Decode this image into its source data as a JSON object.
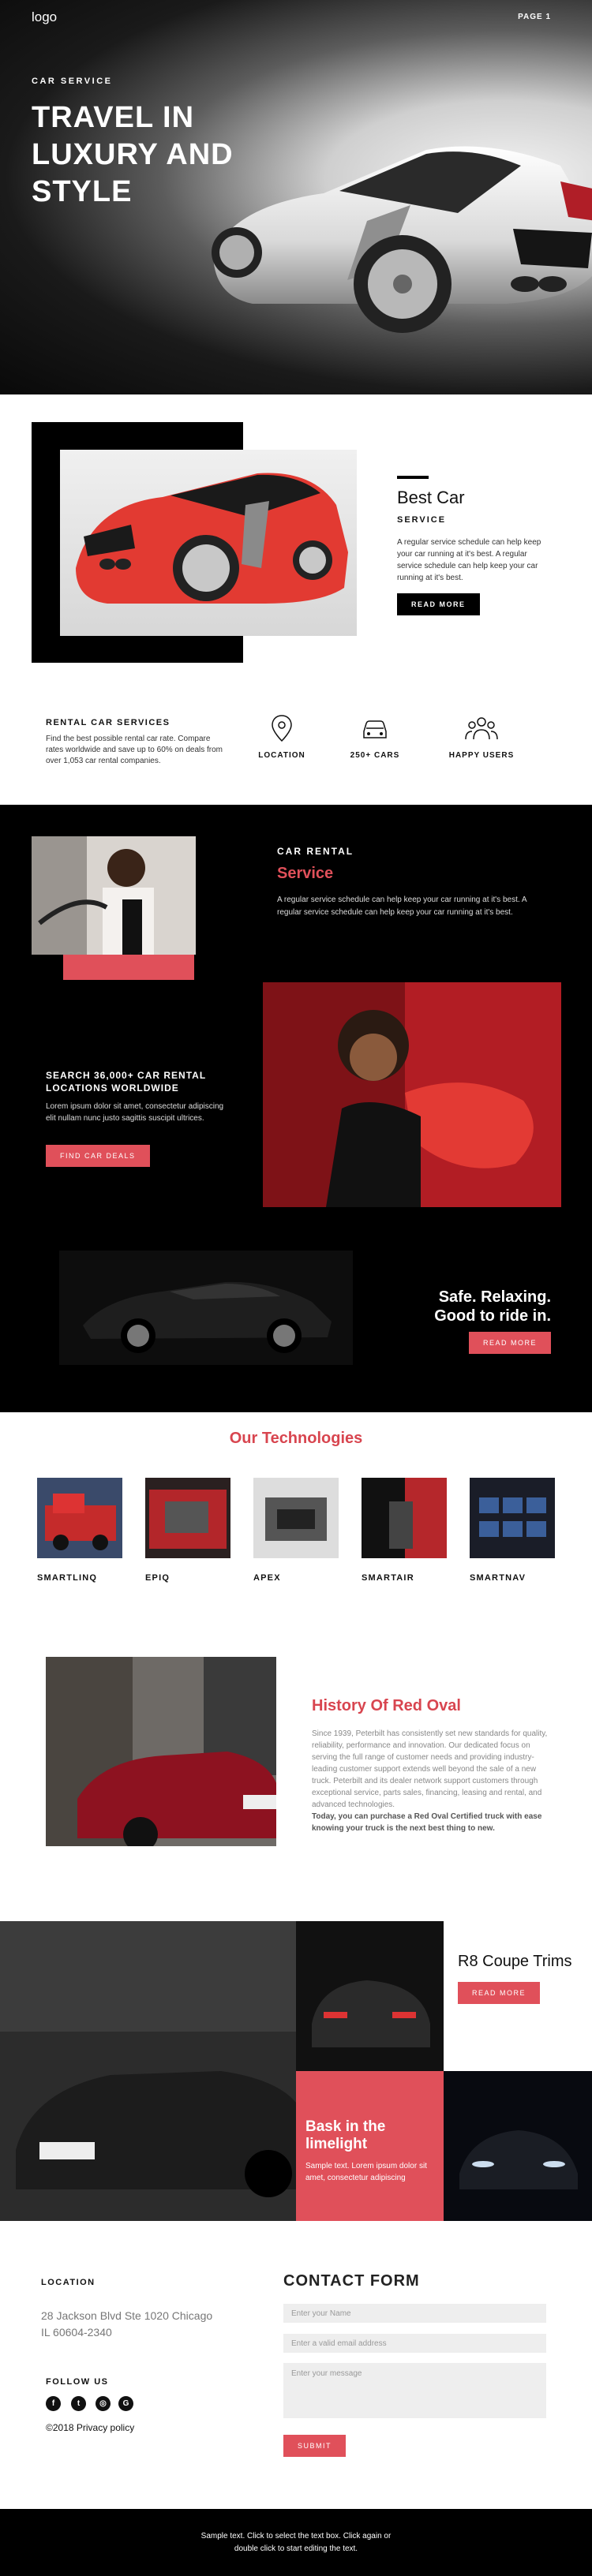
{
  "header": {
    "logo": "logo",
    "page_link": "PAGE 1"
  },
  "hero": {
    "subtitle": "CAR SERVICE",
    "title": "TRAVEL IN LUXURY AND STYLE"
  },
  "best_car": {
    "title": "Best Car",
    "subtitle": "SERVICE",
    "text": "A regular service schedule can help keep your car running at it's best. A regular service schedule can help keep your car running at it's best.",
    "button": "READ MORE"
  },
  "rental": {
    "title": "RENTAL CAR SERVICES",
    "text": "Find the best possible rental car rate. Compare rates worldwide and save up to 60% on deals from over 1,053 car rental companies.",
    "features": [
      {
        "icon": "location-pin-icon",
        "label": "LOCATION"
      },
      {
        "icon": "car-icon",
        "label": "250+ CARS"
      },
      {
        "icon": "users-group-icon",
        "label": "HAPPY USERS"
      }
    ]
  },
  "dark": {
    "label": "CAR RENTAL",
    "title": "Service",
    "text": "A regular service schedule can help keep your car running at it's best. A regular service schedule can help keep your car running at it's best.",
    "search_title": "SEARCH 36,000+ CAR RENTAL LOCATIONS WORLDWIDE",
    "search_text": "Lorem ipsum dolor sit amet, consectetur adipiscing elit nullam nunc justo sagittis suscipit ultrices.",
    "search_button": "FIND CAR DEALS",
    "safe_title": "Safe. Relaxing. Good to ride in.",
    "safe_button": "READ MORE",
    "accent": "#e0505a"
  },
  "tech": {
    "title": "Our Technologies",
    "items": [
      {
        "label": "SMARTLINQ"
      },
      {
        "label": "EPIQ"
      },
      {
        "label": "APEX"
      },
      {
        "label": "SMARTAIR"
      },
      {
        "label": "SMARTNAV"
      }
    ]
  },
  "history": {
    "title": "History Of Red Oval",
    "text": "Since 1939, Peterbilt has consistently set new standards for quality, reliability, performance and innovation. Our dedicated focus on serving the full range of customer needs and providing industry-leading customer support extends well beyond the sale of a new truck. Peterbilt and its dealer network support customers through exceptional service, parts sales, financing, leasing and rental, and advanced technologies.",
    "text_bold": "Today, you can purchase a Red Oval Certified truck with ease knowing your truck is the next best thing to new."
  },
  "r8": {
    "title": "R8 Coupe Trims",
    "button": "READ MORE",
    "limelight_title": "Bask in the limelight",
    "limelight_text": "Sample text. Lorem ipsum dolor sit amet, consectetur adipiscing"
  },
  "contact": {
    "location_heading": "LOCATION",
    "address": "28 Jackson Blvd Ste 1020 Chicago IL 60604-2340",
    "follow_heading": "FOLLOW US",
    "social": [
      {
        "icon": "facebook-icon",
        "glyph": "f"
      },
      {
        "icon": "twitter-icon",
        "glyph": "t"
      },
      {
        "icon": "instagram-icon",
        "glyph": "◎"
      },
      {
        "icon": "google-plus-icon",
        "glyph": "G"
      }
    ],
    "copyright": "©2018 Privacy policy",
    "form_title": "CONTACT FORM",
    "name_placeholder": "Enter your Name",
    "email_placeholder": "Enter a valid email address",
    "message_placeholder": "Enter your message",
    "submit": "SUBMIT"
  },
  "footer": {
    "text": "Sample text. Click to select the text box. Click again or double click to start editing the text."
  }
}
